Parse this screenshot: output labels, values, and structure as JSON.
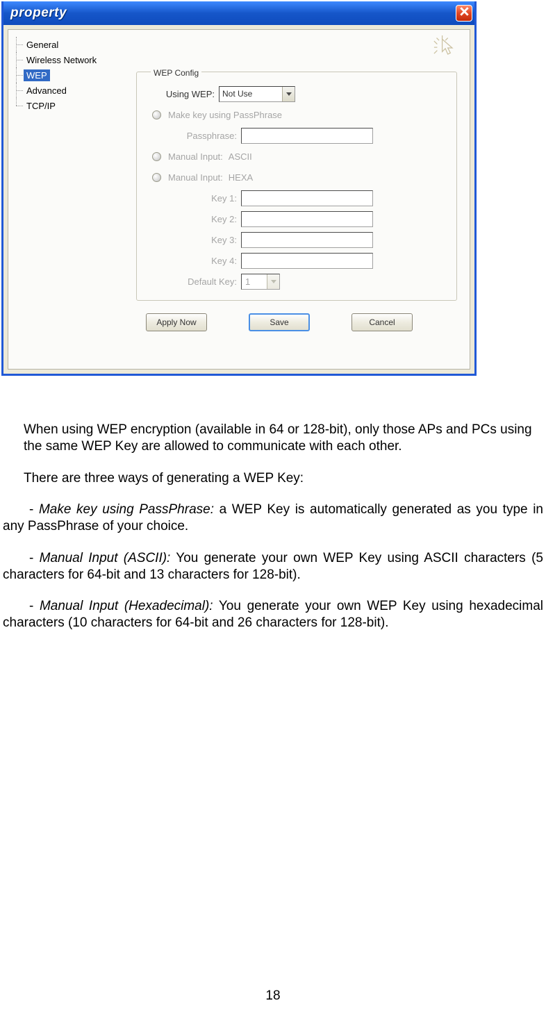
{
  "window": {
    "title": "property"
  },
  "sidebar": {
    "items": [
      {
        "label": "General"
      },
      {
        "label": "Wireless Network"
      },
      {
        "label": "WEP"
      },
      {
        "label": "Advanced"
      },
      {
        "label": "TCP/IP"
      }
    ]
  },
  "fieldset": {
    "legend": "WEP Config",
    "using_wep_label": "Using WEP:",
    "using_wep_value": "Not Use",
    "make_key_label": "Make key using PassPhrase",
    "passphrase_label": "Passphrase:",
    "manual_ascii_label": "Manual Input:",
    "manual_ascii_value": "ASCII",
    "manual_hexa_label": "Manual Input:",
    "manual_hexa_value": "HEXA",
    "key1_label": "Key 1:",
    "key2_label": "Key 2:",
    "key3_label": "Key 3:",
    "key4_label": "Key 4:",
    "default_key_label": "Default Key:",
    "default_key_value": "1"
  },
  "buttons": {
    "apply": "Apply Now",
    "save": "Save",
    "cancel": "Cancel"
  },
  "doc": {
    "p1": "When using WEP encryption (available in 64 or 128-bit), only those APs and PCs using the same WEP Key are allowed to communicate with each other.",
    "p2": "There are three ways of generating a WEP Key:",
    "p3_em": "Make key using PassPhrase:",
    "p3_text": " a WEP Key is automatically generated as you type in any PassPhrase of your choice.",
    "p4_em": "Manual Input (ASCII):",
    "p4_text": " You generate your own WEP Key using ASCII characters (5 characters for 64-bit and 13 characters for 128-bit).",
    "p5_em": "Manual Input (Hexadecimal):",
    "p5_text": " You generate your own WEP Key using hexadecimal characters (10 characters for 64-bit and 26 characters for 128-bit).",
    "page_number": "18"
  }
}
